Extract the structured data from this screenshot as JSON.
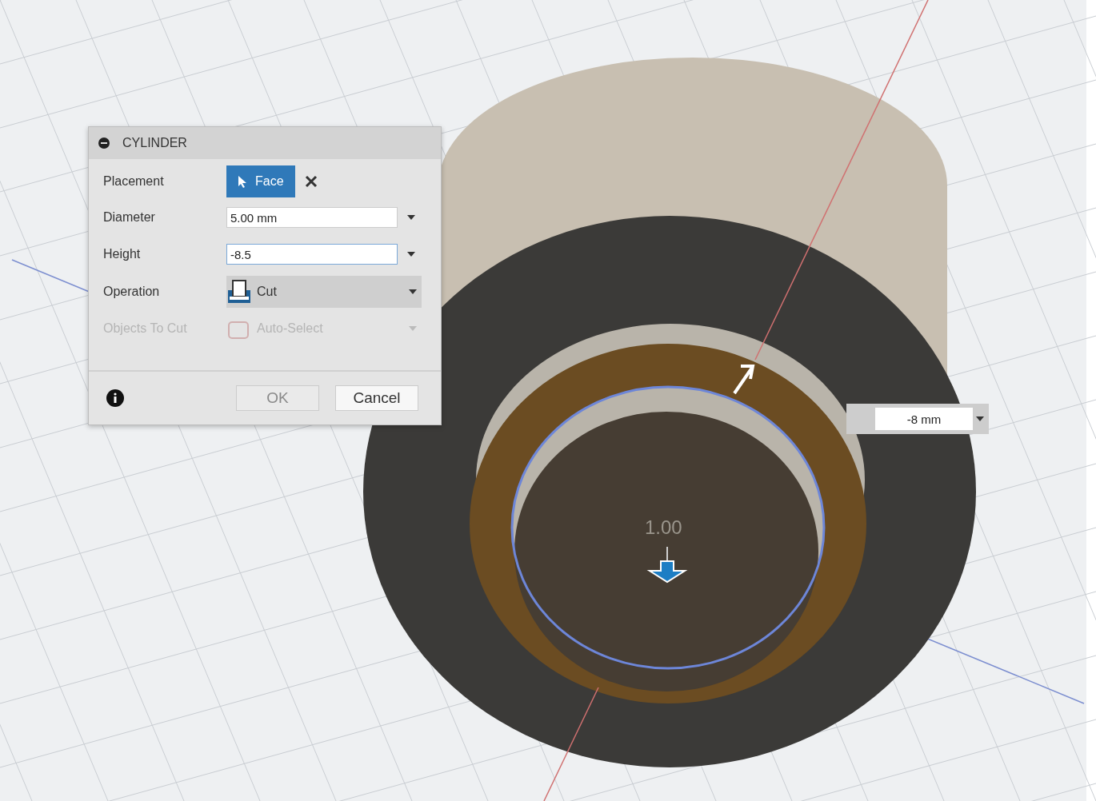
{
  "dialog": {
    "title": "CYLINDER",
    "rows": [
      {
        "kind": "selection",
        "label": "Placement",
        "value": "Face",
        "disabled": false
      },
      {
        "kind": "input",
        "label": "Diameter",
        "value": "5.00 mm",
        "focused": false,
        "disabled": false
      },
      {
        "kind": "input",
        "label": "Height",
        "value": "-8.5",
        "focused": true,
        "disabled": false
      },
      {
        "kind": "dropdown",
        "label": "Operation",
        "value": "Cut",
        "disabled": false
      },
      {
        "kind": "dropdown",
        "label": "Objects To Cut",
        "value": "Auto-Select",
        "disabled": true
      }
    ],
    "buttons": [
      {
        "label": "OK",
        "disabled": true
      },
      {
        "label": "Cancel",
        "disabled": false
      }
    ]
  },
  "viewport": {
    "dimension_input": {
      "value": "-8 mm"
    },
    "manipulator_label": "1.00"
  }
}
